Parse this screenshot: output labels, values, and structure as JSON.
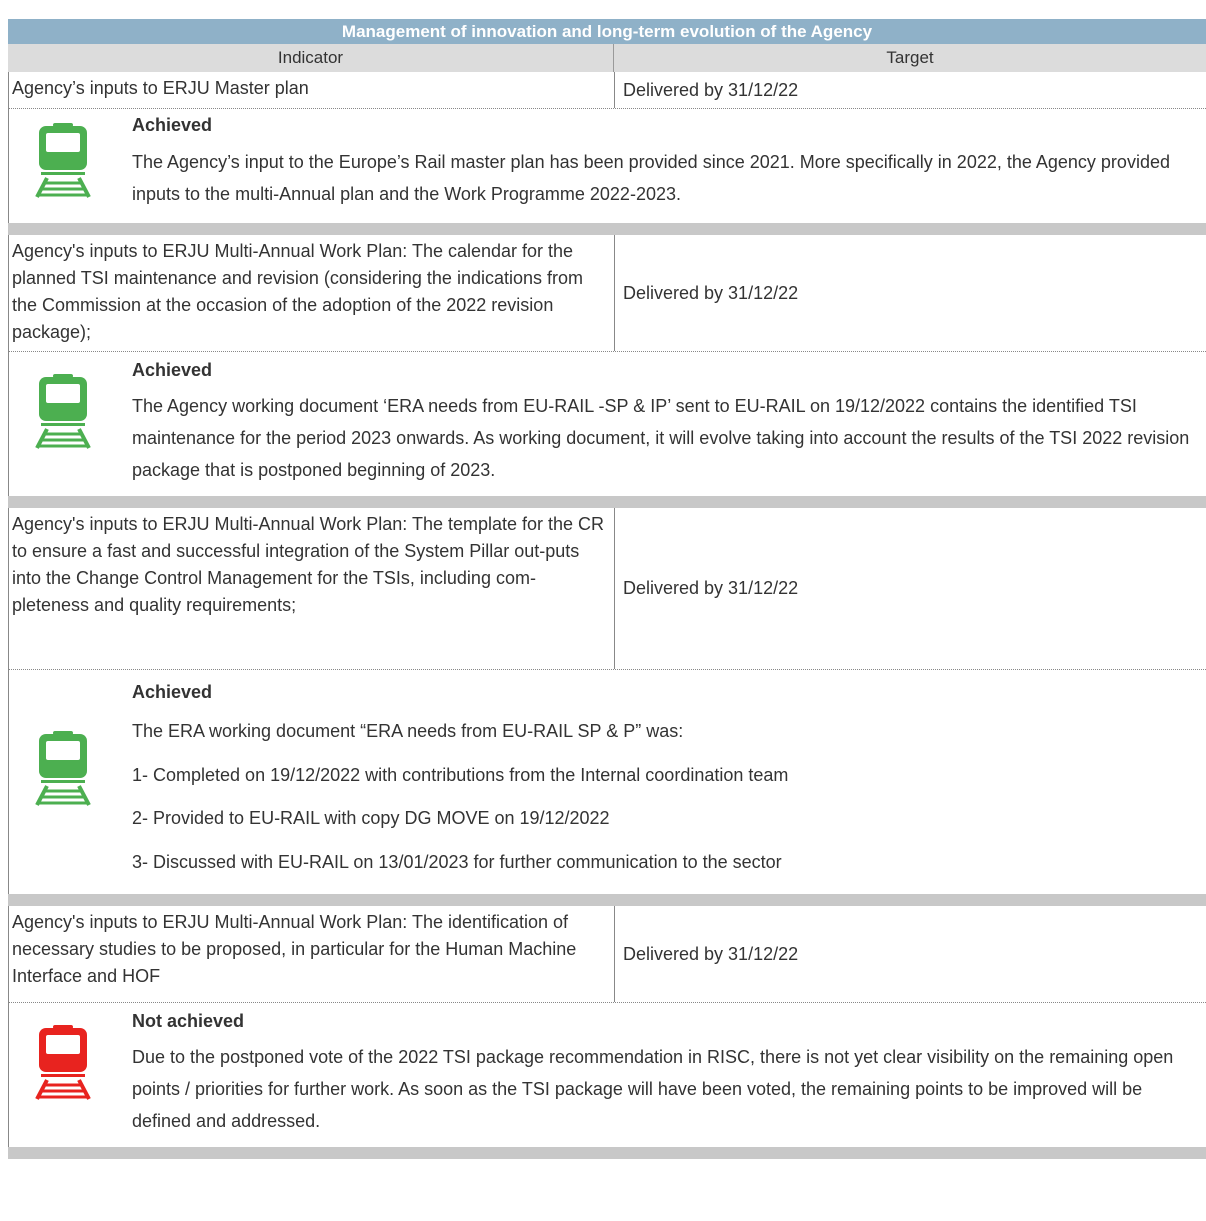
{
  "table": {
    "title": "Management of innovation and long-term evolution of the Agency",
    "header": {
      "indicator": "Indicator",
      "target": "Target"
    },
    "colors": {
      "title_bg": "#8FB1C8",
      "header_bg": "#DCDCDC",
      "separator_bg": "#C8C8C8",
      "achieved": "#4CAF50",
      "not_achieved": "#E8231F"
    },
    "rows": [
      {
        "indicator": "Agency’s inputs to ERJU Master plan",
        "target": "Delivered by 31/12/22",
        "status": "Achieved",
        "icon": "train-icon-green",
        "text": "The Agency’s input to the Europe’s Rail master plan has been provided since 2021. More specifically in 2022, the Agency provided inputs to the multi-Annual plan and the Work Programme 2022-2023."
      },
      {
        "indicator": "Agency's inputs to ERJU Multi-Annual Work Plan: The calendar for the planned TSI maintenance and revision (considering the indications from the Commission at the occasion of the adoption of the 2022 revision package);",
        "target": "Delivered by 31/12/22",
        "status": "Achieved",
        "icon": "train-icon-green",
        "text": "The Agency working document ‘ERA needs from EU-RAIL -SP & IP’ sent to EU-RAIL on 19/12/2022 contains the identified TSI maintenance for the period 2023 onwards. As working document, it will evolve taking into account the results of the TSI 2022 revision package that is postponed beginning of 2023."
      },
      {
        "indicator": "Agency's inputs to ERJU Multi-Annual Work Plan: The template for the CR to ensure a fast and successful integration of the System Pillar out-puts into the Change Control Management for the TSIs, including com-pleteness and quality requirements;",
        "target": "Delivered by 31/12/22",
        "status": "Achieved",
        "icon": "train-icon-green",
        "lines": [
          "The ERA working document “ERA needs from EU-RAIL SP & P” was:",
          "1- Completed on 19/12/2022 with contributions from the Internal coordination team",
          "2- Provided to EU-RAIL with copy DG MOVE on 19/12/2022",
          "3- Discussed with EU-RAIL on 13/01/2023 for further communication to the sector"
        ]
      },
      {
        "indicator": "Agency's inputs to ERJU Multi-Annual Work Plan: The identification of necessary studies to be proposed, in particular for the Human Machine Interface and HOF",
        "target": "Delivered by 31/12/22",
        "status": "Not achieved",
        "icon": "train-icon-red",
        "text": "Due to the postponed vote of the 2022 TSI package recommendation in RISC, there is not yet clear visibility on the remaining open points / priorities for further work. As soon as the TSI package will have been voted, the remaining points to be improved will be defined and addressed."
      }
    ]
  }
}
